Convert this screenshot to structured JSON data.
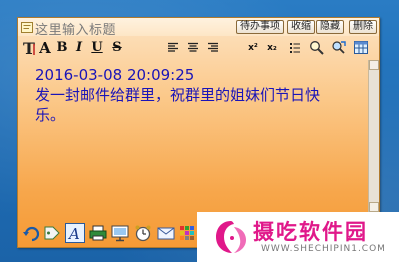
{
  "note": {
    "title_placeholder": "这里输入标题",
    "title_buttons": [
      "待办事项",
      "收缩",
      "隐藏",
      "删除"
    ],
    "toolbar": {
      "font_size_label": "A",
      "bold_label": "B",
      "italic_label": "I",
      "underline_label": "U",
      "strike_label": "S",
      "superscript_label": "x²",
      "subscript_label": "x₂"
    },
    "content": {
      "timestamp": "2016-03-08 20:09:25",
      "line1": "发一封邮件给群里，祝群里的姐妹们节日快",
      "line2": "乐。"
    },
    "bottom_toolbar_icons": [
      "undo-icon",
      "tag-icon",
      "font-icon",
      "printer-icon",
      "screen-icon",
      "alarm-clock-icon",
      "mail-icon",
      "color-palette-icon"
    ]
  },
  "watermark": {
    "text": "摄吃软件园",
    "url": "WWW.SHECHIPIN1.COM"
  },
  "colors": {
    "note_top": "#fde3c2",
    "note_bottom": "#f59a35",
    "content_text": "#1a14b8",
    "watermark_pink": "#e0188a",
    "desktop": "#1f6fb8"
  }
}
